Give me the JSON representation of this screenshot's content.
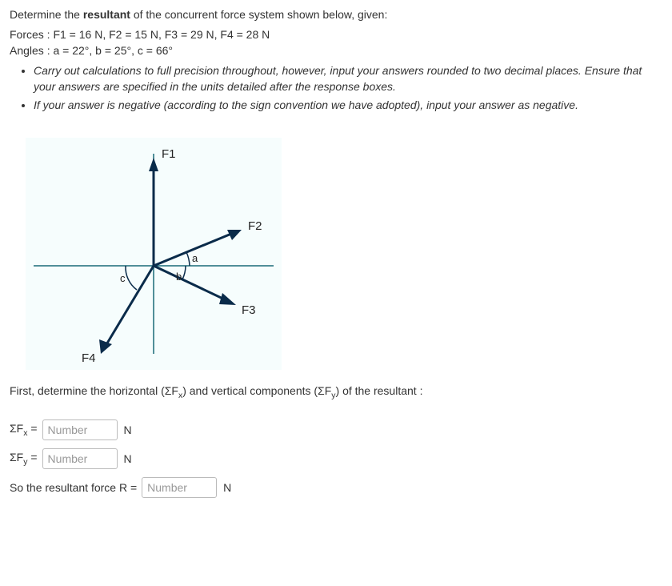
{
  "intro": {
    "line1_prefix": "Determine the ",
    "line1_bold": "resultant",
    "line1_suffix": " of the concurrent force system shown below, given:",
    "forces_line": "Forces : F1 = 16 N, F2 = 15 N, F3 = 29 N, F4 = 28 N",
    "angles_line": "Angles : a = 22°, b = 25°, c = 66°"
  },
  "instructions": {
    "item1": "Carry out calculations to full precision throughout, however, input your answers rounded to two decimal places. Ensure that your answers are specified in the units detailed after the response boxes.",
    "item2": "If your answer is negative (according to the sign convention we have adopted), input your answer as negative."
  },
  "diagram": {
    "labels": {
      "F1": "F1",
      "F2": "F2",
      "F3": "F3",
      "F4": "F4",
      "a": "a",
      "b": "b",
      "c": "c"
    }
  },
  "after_diagram": {
    "text_prefix": "First, determine the horizontal (ΣF",
    "text_sub1": "x",
    "text_mid": ") and vertical components (ΣF",
    "text_sub2": "y",
    "text_suffix": ") of the resultant :"
  },
  "answers": {
    "sfx": {
      "label_prefix": "ΣF",
      "label_sub": "x",
      "label_eq": " = ",
      "placeholder": "Number",
      "unit": "N"
    },
    "sfy": {
      "label_prefix": "ΣF",
      "label_sub": "y",
      "label_eq": " = ",
      "placeholder": "Number",
      "unit": "N"
    },
    "r": {
      "label": "So the resultant force R = ",
      "placeholder": "Number",
      "unit": "N"
    }
  }
}
